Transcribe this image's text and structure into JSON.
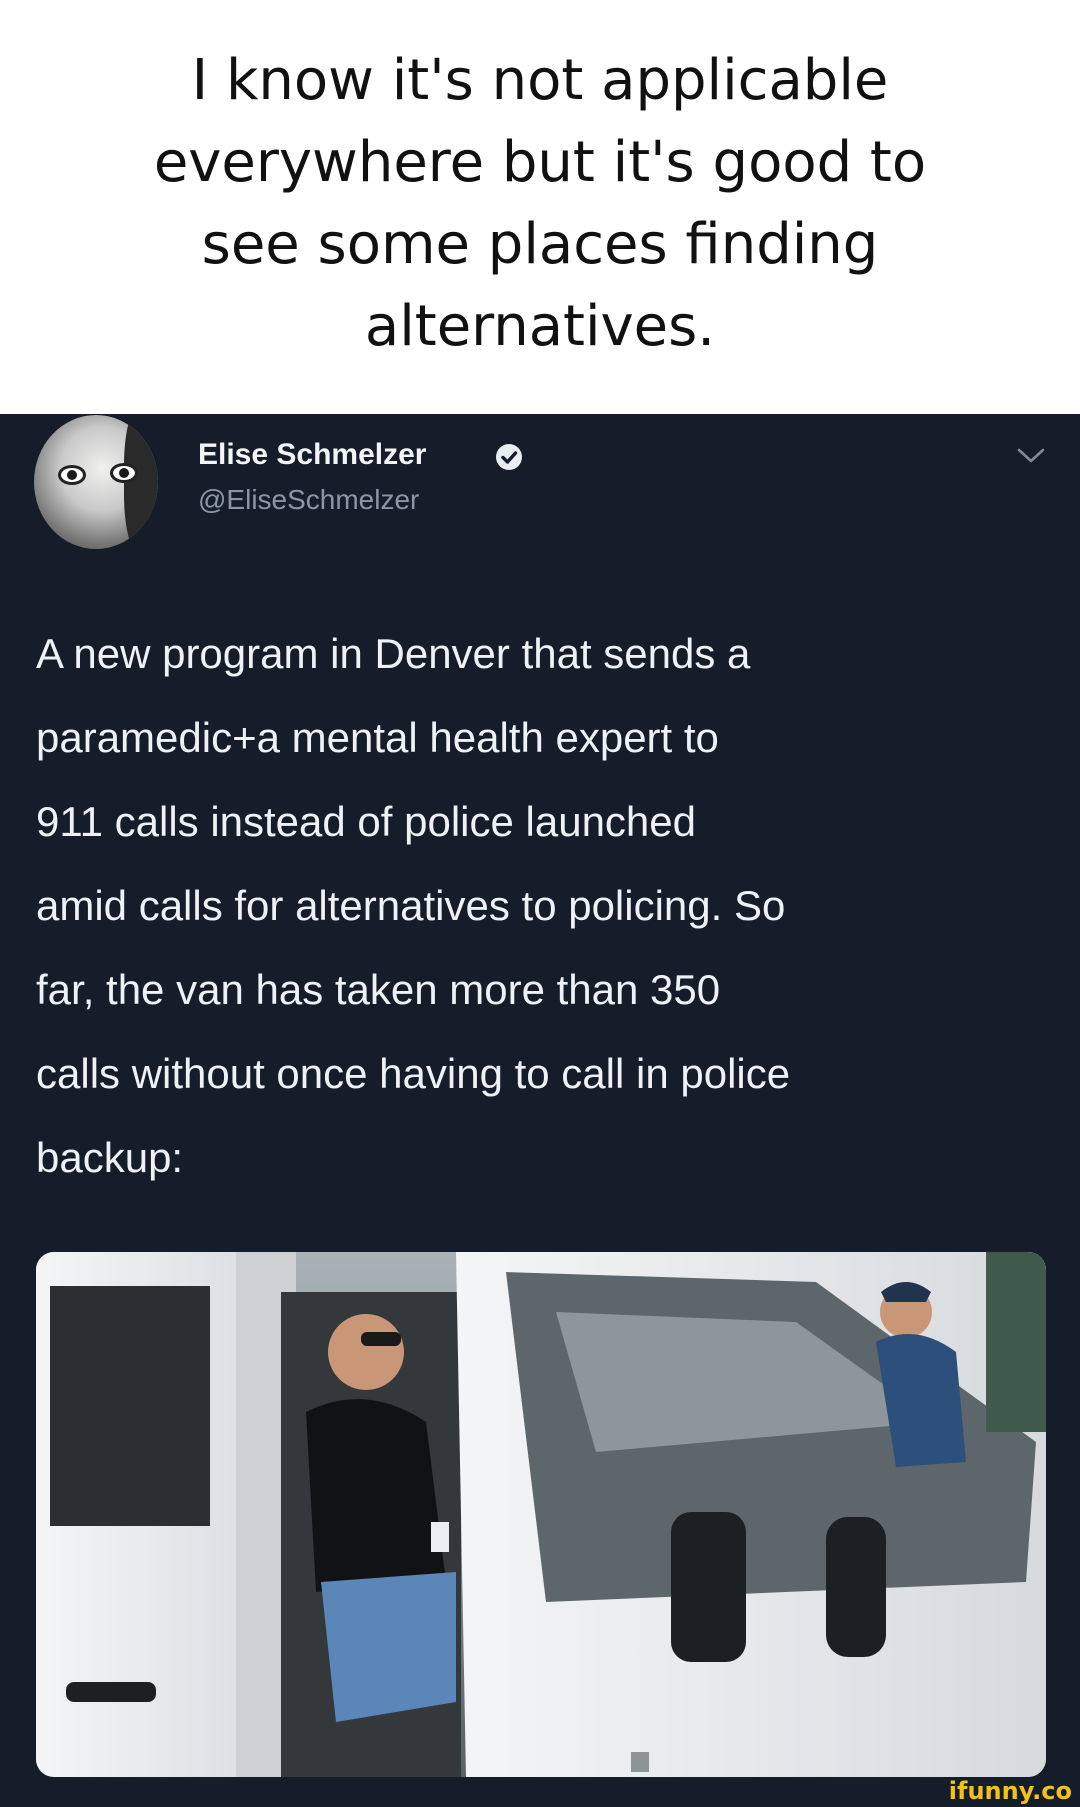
{
  "caption": {
    "line1": "I know it's not applicable",
    "line2": "everywhere but it's good to",
    "line3": "see some places finding",
    "line4": "alternatives."
  },
  "tweet": {
    "author_name": "Elise Schmelzer",
    "handle": "@EliseSchmelzer",
    "text": "A new program in Denver that sends a\nparamedic+a mental health expert to\n911 calls instead of police launched\namid calls for alternatives to policing. So\nfar, the van has taken more than 350\ncalls without once having to call in police\nbackup:",
    "background_color": "#151d2a",
    "verified_icon": "verified-badge-icon",
    "menu_icon": "chevron-down-icon"
  },
  "watermark": {
    "text": "ifunny.co"
  }
}
